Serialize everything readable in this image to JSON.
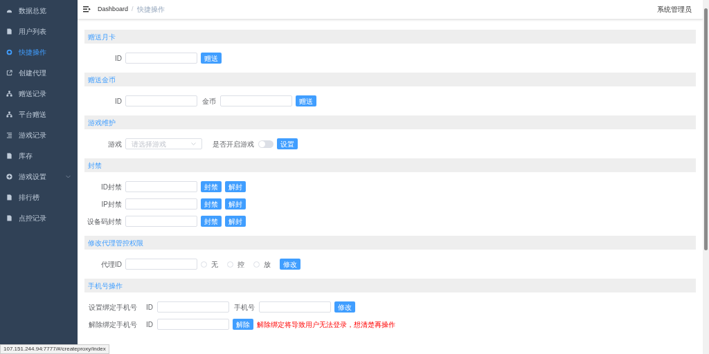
{
  "sidebar": {
    "items": [
      {
        "label": "数据总览",
        "selected": false,
        "kind": "link"
      },
      {
        "label": "用户列表",
        "selected": false,
        "kind": "link"
      },
      {
        "label": "快捷操作",
        "selected": true,
        "kind": "link"
      },
      {
        "label": "创建代理",
        "selected": false,
        "kind": "link"
      },
      {
        "label": "赠送记录",
        "selected": false,
        "kind": "link"
      },
      {
        "label": "平台赠送",
        "selected": false,
        "kind": "link"
      },
      {
        "label": "游戏记录",
        "selected": false,
        "kind": "link"
      },
      {
        "label": "库存",
        "selected": false,
        "kind": "link"
      },
      {
        "label": "游戏设置",
        "selected": false,
        "kind": "submenu"
      },
      {
        "label": "排行榜",
        "selected": false,
        "kind": "link"
      },
      {
        "label": "点控记录",
        "selected": false,
        "kind": "link"
      }
    ]
  },
  "header": {
    "breadcrumb": [
      "Dashboard",
      "快捷操作"
    ],
    "separator": "/",
    "user": "系统管理员"
  },
  "sections": [
    {
      "title": "赠送月卡",
      "rows": [
        [
          {
            "kind": "label",
            "text": "ID"
          },
          {
            "kind": "input"
          },
          {
            "kind": "button",
            "text": "赠送"
          }
        ]
      ]
    },
    {
      "title": "赠送金币",
      "rows": [
        [
          {
            "kind": "label",
            "text": "ID"
          },
          {
            "kind": "input"
          },
          {
            "kind": "tag",
            "text": "金币"
          },
          {
            "kind": "input"
          },
          {
            "kind": "button",
            "text": "赠送"
          }
        ]
      ]
    },
    {
      "title": "游戏维护",
      "rows": [
        [
          {
            "kind": "label",
            "text": "游戏"
          },
          {
            "kind": "select",
            "placeholder": "请选择游戏"
          },
          {
            "kind": "tag",
            "text": "是否开启游戏"
          },
          {
            "kind": "switch",
            "on": false
          },
          {
            "kind": "button",
            "text": "设置"
          }
        ]
      ]
    },
    {
      "title": "封禁",
      "rows": [
        [
          {
            "kind": "label",
            "text": "ID封禁"
          },
          {
            "kind": "input"
          },
          {
            "kind": "button",
            "text": "封禁"
          },
          {
            "kind": "button",
            "text": "解封"
          }
        ],
        [
          {
            "kind": "label",
            "text": "IP封禁"
          },
          {
            "kind": "input"
          },
          {
            "kind": "button",
            "text": "封禁"
          },
          {
            "kind": "button",
            "text": "解封"
          }
        ],
        [
          {
            "kind": "label",
            "text": "设备码封禁"
          },
          {
            "kind": "input"
          },
          {
            "kind": "button",
            "text": "封禁"
          },
          {
            "kind": "button",
            "text": "解封"
          }
        ]
      ]
    },
    {
      "title": "修改代理管控权限",
      "rows": [
        [
          {
            "kind": "label",
            "text": "代理ID"
          },
          {
            "kind": "input"
          },
          {
            "kind": "radio",
            "text": "无",
            "selected": false
          },
          {
            "kind": "radio",
            "text": "控",
            "selected": false
          },
          {
            "kind": "radio",
            "text": "放",
            "selected": false
          },
          {
            "kind": "button",
            "text": "修改"
          }
        ]
      ]
    },
    {
      "title": "手机号操作",
      "rows": [
        [
          {
            "kind": "title",
            "text": "设置绑定手机号"
          },
          {
            "kind": "tag",
            "text": "ID"
          },
          {
            "kind": "input"
          },
          {
            "kind": "tag",
            "text": "手机号"
          },
          {
            "kind": "input"
          },
          {
            "kind": "button",
            "text": "修改"
          }
        ],
        [
          {
            "kind": "title",
            "text": "解除绑定手机号"
          },
          {
            "kind": "tag",
            "text": "ID"
          },
          {
            "kind": "input"
          },
          {
            "kind": "button",
            "text": "解除"
          },
          {
            "kind": "warning",
            "text": "解除绑定将导致用户无法登录，想清楚再操作"
          }
        ]
      ]
    }
  ],
  "status_bar": {
    "url": "107.151.244.94:7777/#/createproxy/index"
  }
}
